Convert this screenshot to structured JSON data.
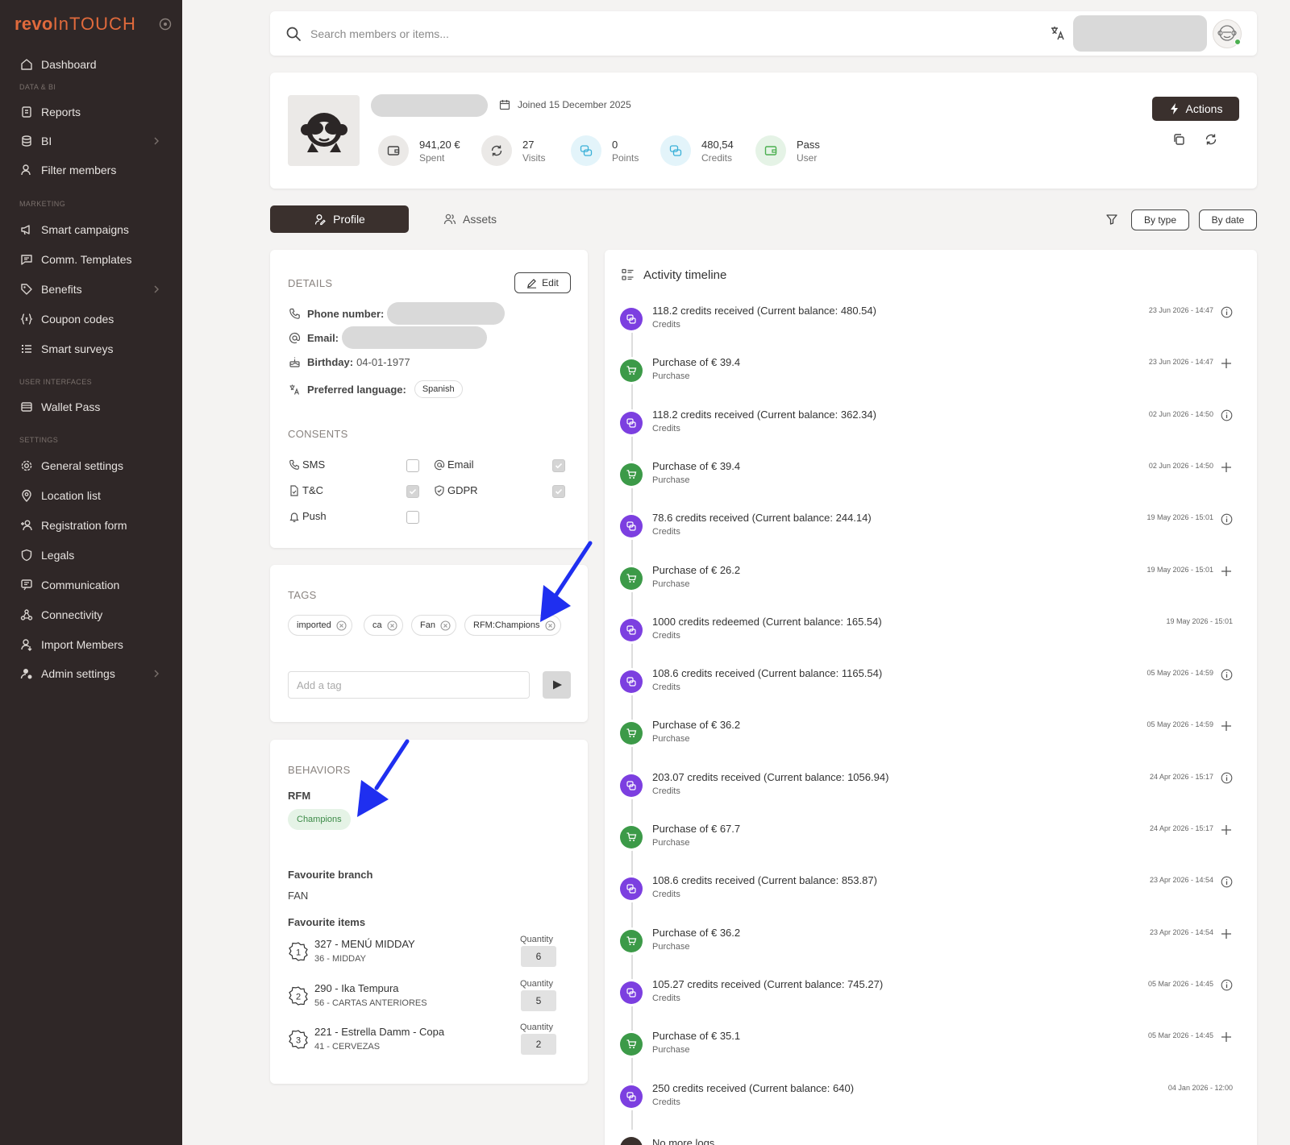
{
  "brand": {
    "part1": "revo",
    "part2": "InTOUCH"
  },
  "sidebar": {
    "sections": {
      "data_bi": "DATA & BI",
      "marketing": "MARKETING",
      "user_interfaces": "USER INTERFACES",
      "settings": "SETTINGS"
    },
    "items": [
      {
        "label": "Dashboard",
        "icon": "home-icon"
      },
      {
        "label": "Reports",
        "icon": "report-icon"
      },
      {
        "label": "BI",
        "icon": "database-icon",
        "chevron": true
      },
      {
        "label": "Filter members",
        "icon": "user-filter-icon"
      },
      {
        "label": "Smart campaigns",
        "icon": "megaphone-icon"
      },
      {
        "label": "Comm. Templates",
        "icon": "message-icon"
      },
      {
        "label": "Benefits",
        "icon": "tag-icon",
        "chevron": true
      },
      {
        "label": "Coupon codes",
        "icon": "braces-icon"
      },
      {
        "label": "Smart surveys",
        "icon": "list-icon"
      },
      {
        "label": "Wallet Pass",
        "icon": "wallet-icon"
      },
      {
        "label": "General settings",
        "icon": "gear-icon"
      },
      {
        "label": "Location list",
        "icon": "pin-icon"
      },
      {
        "label": "Registration form",
        "icon": "user-plus-icon"
      },
      {
        "label": "Legals",
        "icon": "shield-icon"
      },
      {
        "label": "Communication",
        "icon": "chat-icon"
      },
      {
        "label": "Connectivity",
        "icon": "link-icon"
      },
      {
        "label": "Import Members",
        "icon": "user-import-icon"
      },
      {
        "label": "Admin settings",
        "icon": "admin-icon",
        "chevron": true
      }
    ]
  },
  "search": {
    "placeholder": "Search members or items..."
  },
  "member": {
    "joined": "Joined 15 December 2025",
    "stats": [
      {
        "value": "941,20 €",
        "label": "Spent"
      },
      {
        "value": "27",
        "label": "Visits"
      },
      {
        "value": "0",
        "label": "Points"
      },
      {
        "value": "480,54",
        "label": "Credits"
      },
      {
        "value": "Pass",
        "label": "User"
      }
    ],
    "actions_label": "Actions"
  },
  "tabs": {
    "profile": "Profile",
    "assets": "Assets"
  },
  "filters": {
    "by_type": "By type",
    "by_date": "By date"
  },
  "details": {
    "title": "DETAILS",
    "edit_label": "Edit",
    "phone_label": "Phone number:",
    "email_label": "Email:",
    "birthday_label": "Birthday:",
    "birthday_value": "04-01-1977",
    "language_label": "Preferred language:",
    "language_value": "Spanish"
  },
  "consents": {
    "title": "CONSENTS",
    "sms": "SMS",
    "sms_checked": false,
    "email": "Email",
    "email_checked": true,
    "tc": "T&C",
    "tc_checked": true,
    "gdpr": "GDPR",
    "gdpr_checked": true,
    "push": "Push",
    "push_checked": false
  },
  "tags": {
    "title": "TAGS",
    "items": [
      "imported",
      "ca",
      "Fan",
      "RFM:Champions"
    ],
    "input_placeholder": "Add a tag"
  },
  "behaviors": {
    "title": "BEHAVIORS",
    "rfm_label": "RFM",
    "rfm_value": "Champions",
    "fav_branch_label": "Favourite branch",
    "fav_branch_value": "FAN",
    "fav_items_label": "Favourite items",
    "quantity_label": "Quantity",
    "items": [
      {
        "name": "327 - MENÚ MIDDAY",
        "sub": "36 - MIDDAY",
        "qty": "6"
      },
      {
        "name": "290 - Ika Tempura",
        "sub": "56 - CARTAS ANTERIORES",
        "qty": "5"
      },
      {
        "name": "221 - Estrella Damm - Copa",
        "sub": "41 - CERVEZAS",
        "qty": "2"
      }
    ]
  },
  "timeline": {
    "title": "Activity timeline",
    "events": [
      {
        "title": "118.2 credits received (Current balance: 480.54)",
        "type": "Credits",
        "date": "23 Jun 2026 - 14:47",
        "kind": "credit"
      },
      {
        "title": "Purchase of € 39.4",
        "type": "Purchase",
        "date": "23 Jun 2026 - 14:47",
        "kind": "purchase"
      },
      {
        "title": "118.2 credits received (Current balance: 362.34)",
        "type": "Credits",
        "date": "02 Jun 2026 - 14:50",
        "kind": "credit"
      },
      {
        "title": "Purchase of € 39.4",
        "type": "Purchase",
        "date": "02 Jun 2026 - 14:50",
        "kind": "purchase"
      },
      {
        "title": "78.6 credits received (Current balance: 244.14)",
        "type": "Credits",
        "date": "19 May 2026 - 15:01",
        "kind": "credit"
      },
      {
        "title": "Purchase of € 26.2",
        "type": "Purchase",
        "date": "19 May 2026 - 15:01",
        "kind": "purchase"
      },
      {
        "title": "1000 credits redeemed (Current balance: 165.54)",
        "type": "Credits",
        "date": "19 May 2026 - 15:01",
        "kind": "redeem"
      },
      {
        "title": "108.6 credits received (Current balance: 1165.54)",
        "type": "Credits",
        "date": "05 May 2026 - 14:59",
        "kind": "credit"
      },
      {
        "title": "Purchase of € 36.2",
        "type": "Purchase",
        "date": "05 May 2026 - 14:59",
        "kind": "purchase"
      },
      {
        "title": "203.07 credits received (Current balance: 1056.94)",
        "type": "Credits",
        "date": "24 Apr 2026 - 15:17",
        "kind": "credit"
      },
      {
        "title": "Purchase of € 67.7",
        "type": "Purchase",
        "date": "24 Apr 2026 - 15:17",
        "kind": "purchase"
      },
      {
        "title": "108.6 credits received (Current balance: 853.87)",
        "type": "Credits",
        "date": "23 Apr 2026 - 14:54",
        "kind": "credit"
      },
      {
        "title": "Purchase of € 36.2",
        "type": "Purchase",
        "date": "23 Apr 2026 - 14:54",
        "kind": "purchase"
      },
      {
        "title": "105.27 credits received (Current balance: 745.27)",
        "type": "Credits",
        "date": "05 Mar 2026 - 14:45",
        "kind": "credit"
      },
      {
        "title": "Purchase of € 35.1",
        "type": "Purchase",
        "date": "05 Mar 2026 - 14:45",
        "kind": "purchase"
      },
      {
        "title": "250 credits received (Current balance: 640)",
        "type": "Credits",
        "date": "04 Jan 2026 - 12:00",
        "kind": "redeem"
      }
    ],
    "end_label": "No more logs"
  },
  "colors": {
    "accent": "#e06a3c",
    "sidebar": "#2f2727",
    "credit": "#7c3fe0",
    "purchase": "#3c9a48",
    "annotation_arrow": "#1f2ff0"
  }
}
